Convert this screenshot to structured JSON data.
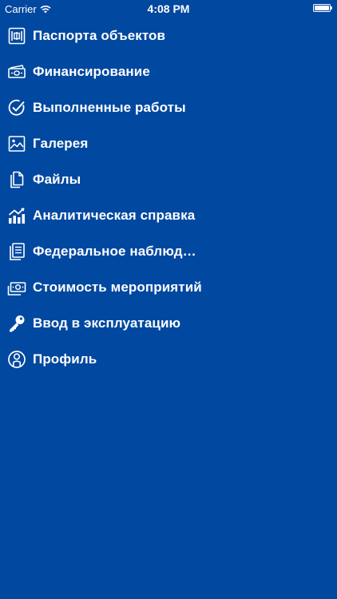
{
  "status_bar": {
    "carrier": "Carrier",
    "time": "4:08 PM",
    "battery_level": 1.0
  },
  "menu": {
    "items": [
      {
        "label": "Паспорта объектов",
        "icon": "object-passport-icon"
      },
      {
        "label": "Финансирование",
        "icon": "money-icon"
      },
      {
        "label": "Выполненные работы",
        "icon": "check-circle-icon"
      },
      {
        "label": "Галерея",
        "icon": "gallery-image-icon"
      },
      {
        "label": "Файлы",
        "icon": "files-icon"
      },
      {
        "label": "Аналитическая справка",
        "icon": "analytics-chart-icon"
      },
      {
        "label": "Федеральное наблюд…",
        "icon": "documents-list-icon"
      },
      {
        "label": "Стоимость мероприятий",
        "icon": "cost-cash-icon"
      },
      {
        "label": "Ввод в эксплуатацию",
        "icon": "key-icon"
      },
      {
        "label": "Профиль",
        "icon": "profile-icon"
      }
    ]
  },
  "colors": {
    "background": "#0148a0",
    "foreground": "#ffffff"
  }
}
